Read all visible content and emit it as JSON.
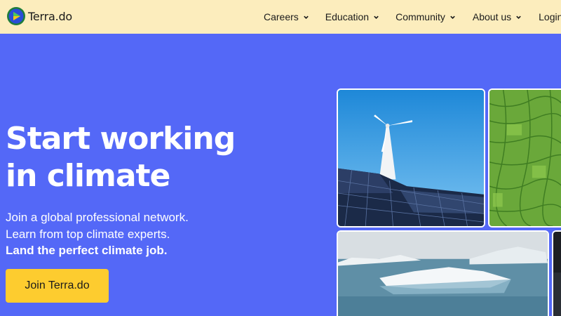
{
  "brand": {
    "name": "Terra.do"
  },
  "nav": {
    "items": [
      {
        "label": "Careers"
      },
      {
        "label": "Education"
      },
      {
        "label": "Community"
      },
      {
        "label": "About us"
      }
    ],
    "login": "Login"
  },
  "hero": {
    "title_line1": "Start working",
    "title_line2": "in climate",
    "sub_line1": "Join a global professional network.",
    "sub_line2": "Learn from top climate experts.",
    "sub_line3": "Land the perfect climate job.",
    "cta": "Join Terra.do"
  },
  "colors": {
    "background": "#5468f7",
    "topbar": "#fcedbd",
    "cta": "#fdcc2f",
    "text_dark": "#1b1b1b"
  },
  "images": [
    {
      "name": "wind-turbine-solar-panels-photo"
    },
    {
      "name": "green-fields-aerial-photo"
    },
    {
      "name": "icebergs-photo"
    },
    {
      "name": "dark-photo"
    }
  ]
}
